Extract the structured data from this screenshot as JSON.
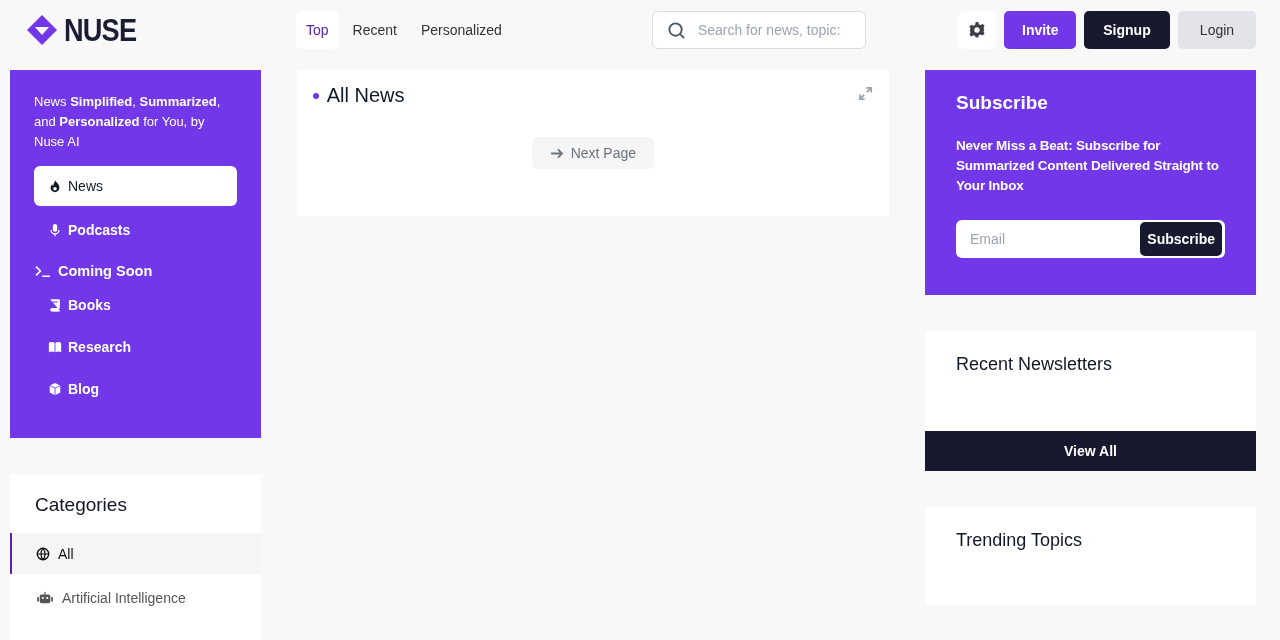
{
  "logo": {
    "text": "NUSE"
  },
  "tabs": [
    {
      "label": "Top",
      "selected": true
    },
    {
      "label": "Recent",
      "selected": false
    },
    {
      "label": "Personalized",
      "selected": false
    }
  ],
  "search": {
    "placeholder": "Search for news, topic:"
  },
  "header_buttons": [
    {
      "label": "Invite",
      "kind": "primary"
    },
    {
      "label": "Signup",
      "kind": "dark"
    },
    {
      "label": "Login",
      "kind": "light"
    }
  ],
  "sidebar": {
    "tagline": "News **Simplified**, **Summarized**, and **Personalized** for You, by Nuse AI",
    "items": [
      {
        "label": "News",
        "selected": true
      },
      {
        "label": "Podcasts",
        "selected": false
      },
      {
        "label": "Coming Soon",
        "children": [
          {
            "label": "Books",
            "selected": false
          },
          {
            "label": "Research",
            "selected": false
          },
          {
            "label": "Blog",
            "selected": false
          }
        ]
      }
    ]
  },
  "categories": {
    "title": "Categories",
    "items": [
      {
        "label": "All",
        "selected": true
      },
      {
        "label": "Artificial Intelligence",
        "selected": false
      }
    ]
  },
  "main": {
    "title": "All News",
    "next_button": "Next Page"
  },
  "subscribe": {
    "title": "Subscribe",
    "text": "Never Miss a Beat: Subscribe for Summarized Content Delivered Straight to Your Inbox",
    "placeholder": "Email",
    "button": "Subscribe"
  },
  "newsletters": {
    "title": "Recent Newsletters",
    "button": "View All"
  },
  "trending": {
    "title": "Trending Topics"
  }
}
